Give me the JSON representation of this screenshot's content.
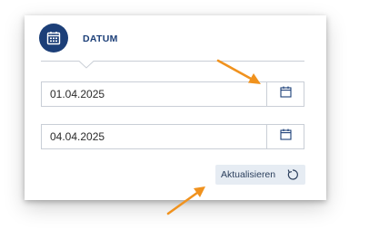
{
  "section": {
    "title": "DATUM",
    "icon": "calendar-icon"
  },
  "date_from": {
    "value": "01.04.2025",
    "button_icon": "calendar-icon"
  },
  "date_to": {
    "value": "04.04.2025",
    "button_icon": "calendar-icon"
  },
  "refresh": {
    "label": "Aktualisieren",
    "icon": "refresh-icon"
  },
  "annotations": {
    "arrow_color": "#f0921e",
    "arrows": [
      "arrow-to-date-from-calendar-button",
      "arrow-to-refresh-button"
    ]
  },
  "colors": {
    "accent": "#1c3f78",
    "button_bg": "#e6ecf3",
    "border": "#c9ced6"
  }
}
